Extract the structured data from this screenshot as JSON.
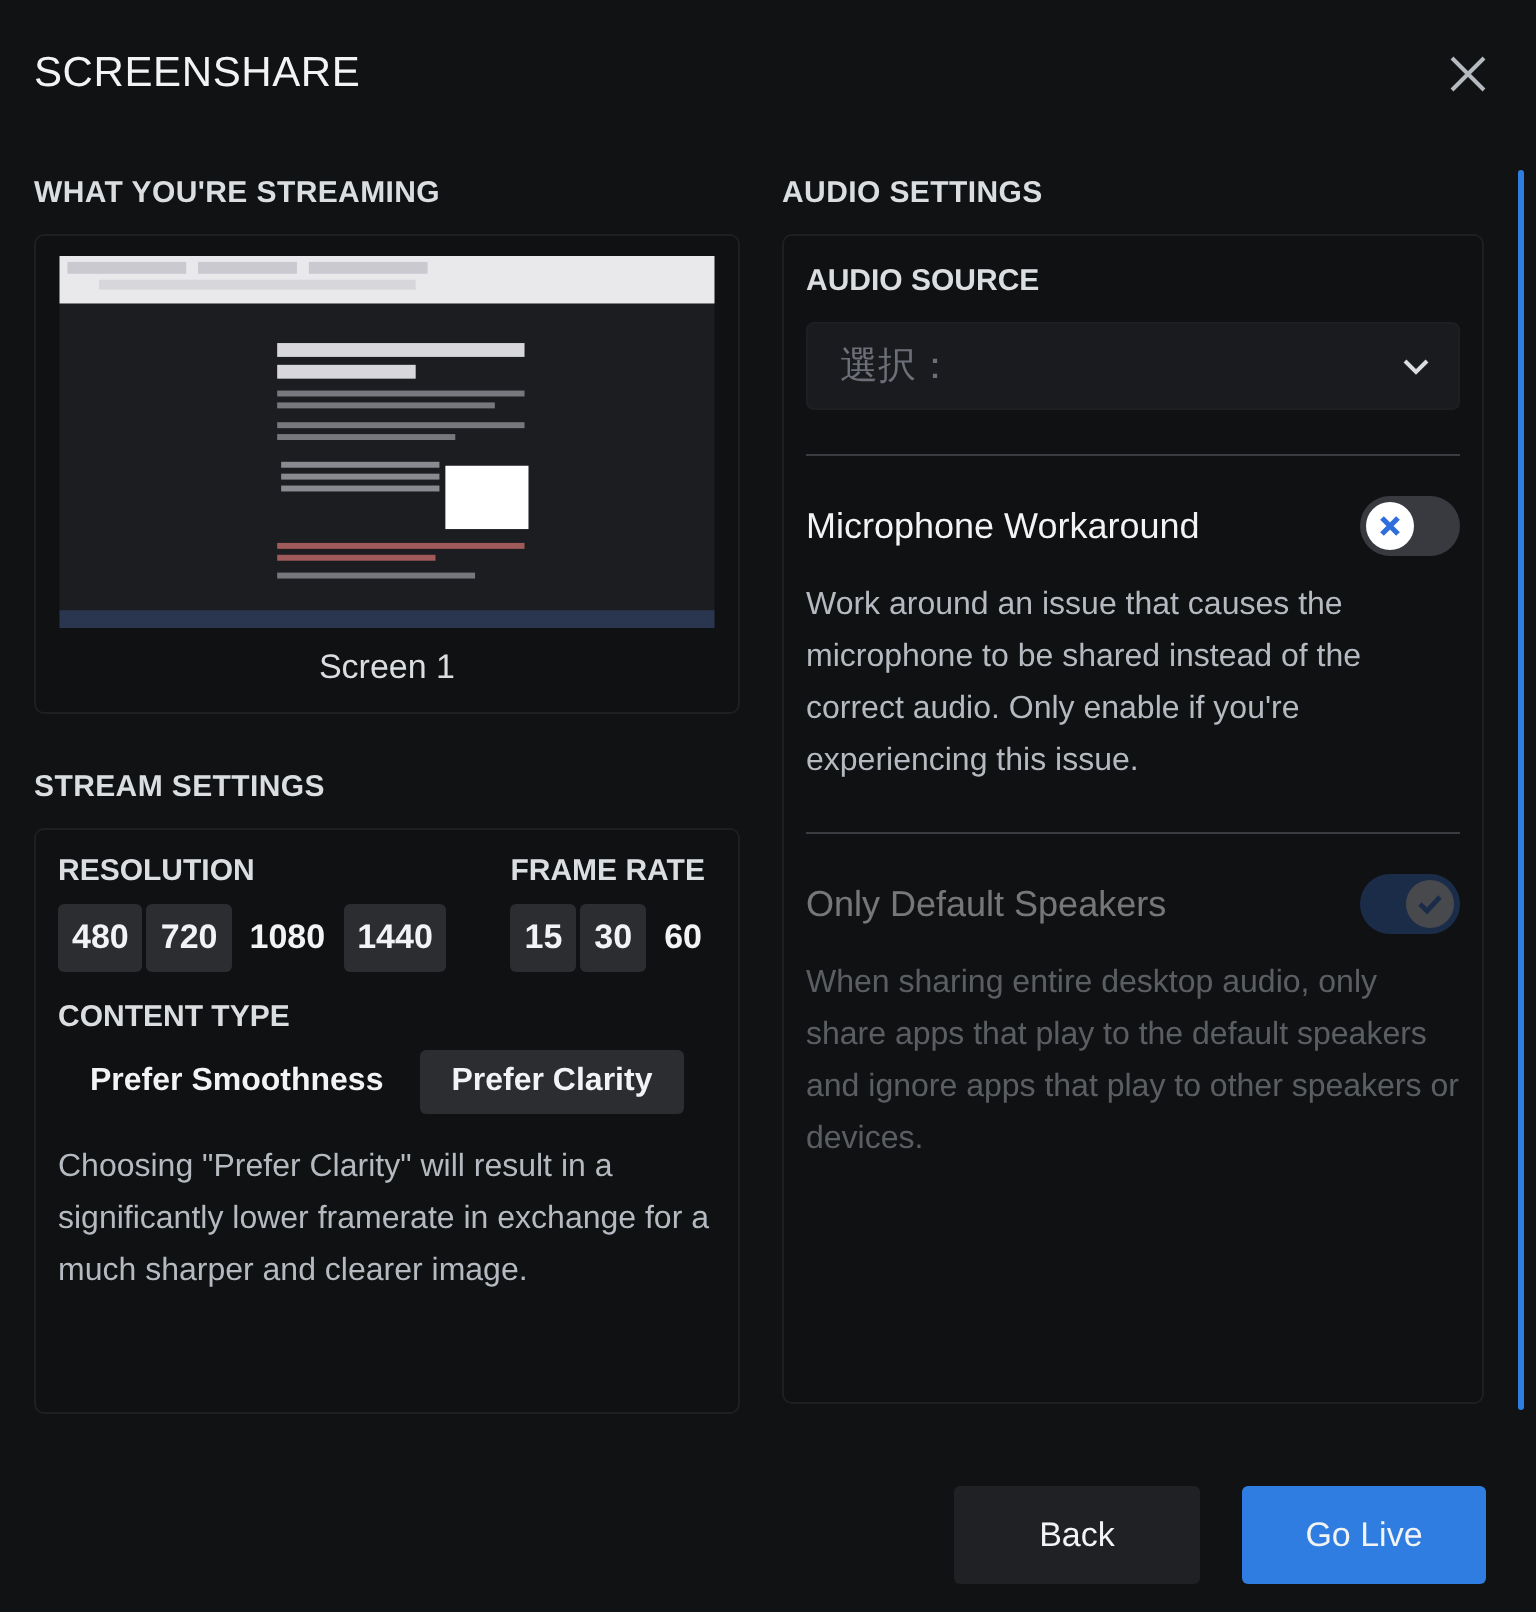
{
  "dialog": {
    "title": "SCREENSHARE"
  },
  "streaming": {
    "heading": "WHAT YOU'RE STREAMING",
    "source_label": "Screen 1"
  },
  "stream_settings": {
    "heading": "STREAM SETTINGS",
    "resolution": {
      "label": "RESOLUTION",
      "options": [
        {
          "label": "480",
          "selected": false
        },
        {
          "label": "720",
          "selected": false
        },
        {
          "label": "1080",
          "selected": true
        },
        {
          "label": "1440",
          "selected": false
        }
      ]
    },
    "frame_rate": {
      "label": "FRAME RATE",
      "options": [
        {
          "label": "15",
          "selected": false
        },
        {
          "label": "30",
          "selected": false
        },
        {
          "label": "60",
          "selected": true
        }
      ]
    },
    "content_type": {
      "label": "CONTENT TYPE",
      "options": [
        {
          "label": "Prefer Smoothness",
          "selected": true
        },
        {
          "label": "Prefer Clarity",
          "selected": false
        }
      ],
      "note": "Choosing \"Prefer Clarity\" will result in a significantly lower framerate in exchange for a much sharper and clearer image."
    }
  },
  "audio_settings": {
    "heading": "AUDIO SETTINGS",
    "audio_source": {
      "label": "AUDIO SOURCE",
      "placeholder": "選択："
    },
    "toggles": [
      {
        "title": "Microphone Workaround",
        "description": "Work around an issue that causes the microphone to be shared instead of the correct audio. Only enable if you're experiencing this issue.",
        "on": false,
        "disabled": false
      },
      {
        "title": "Only Default Speakers",
        "description": "When sharing entire desktop audio, only share apps that play to the default speakers and ignore apps that play to other speakers or devices.",
        "on": true,
        "disabled": true
      }
    ]
  },
  "buttons": [
    {
      "label": "Back",
      "kind": "secondary"
    },
    {
      "label": "Go Live",
      "kind": "primary"
    }
  ]
}
